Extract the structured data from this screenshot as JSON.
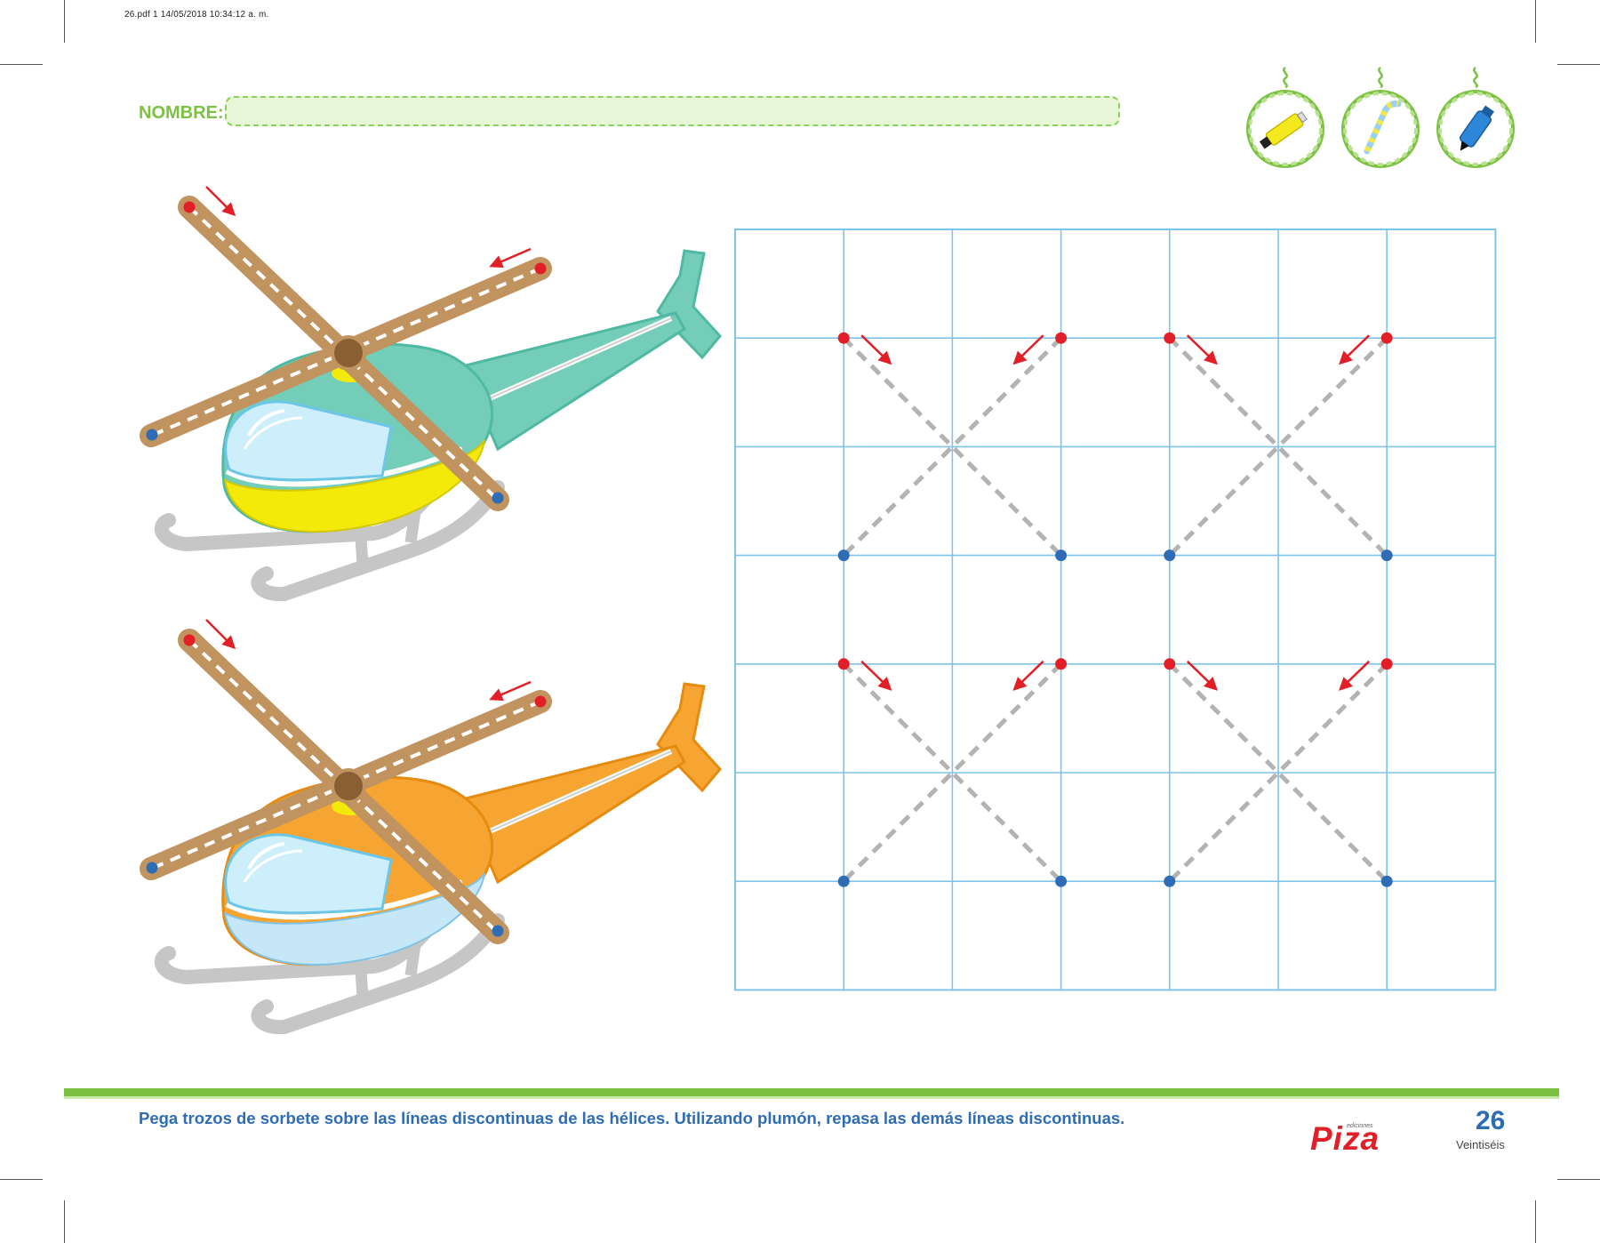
{
  "header": {
    "file_meta": "26.pdf   1   14/05/2018   10:34:12 a. m.",
    "name_label": "NOMBRE:"
  },
  "tools": [
    {
      "icon": "glue-tube-icon",
      "color": "#f3ea1e"
    },
    {
      "icon": "straw-icon",
      "color": "#9ad0f2"
    },
    {
      "icon": "marker-icon",
      "color": "#2e86d9"
    }
  ],
  "helicopters": [
    {
      "body_color": "#74cdb8",
      "belly_color": "#f4ea0a",
      "tail_color": "#74cdb8"
    },
    {
      "body_color": "#f6a432",
      "belly_color": "#c6e7f7",
      "tail_color": "#f6a432"
    }
  ],
  "colors": {
    "grid": "#7fc4e8",
    "start_dot": "#e21f26",
    "end_dot": "#2e6db5",
    "arrow": "#e21f26",
    "dash": "#b3b3b3",
    "rotor": "#c0935f",
    "accent_green": "#7cc242"
  },
  "footer": {
    "instruction": "Pega trozos de sorbete sobre las líneas discontinuas de las hélices. Utilizando plumón, repasa las demás líneas discontinuas.",
    "brand_small": "ediciones",
    "brand": "Piza",
    "page_number": "26",
    "page_word": "Veintiséis"
  }
}
